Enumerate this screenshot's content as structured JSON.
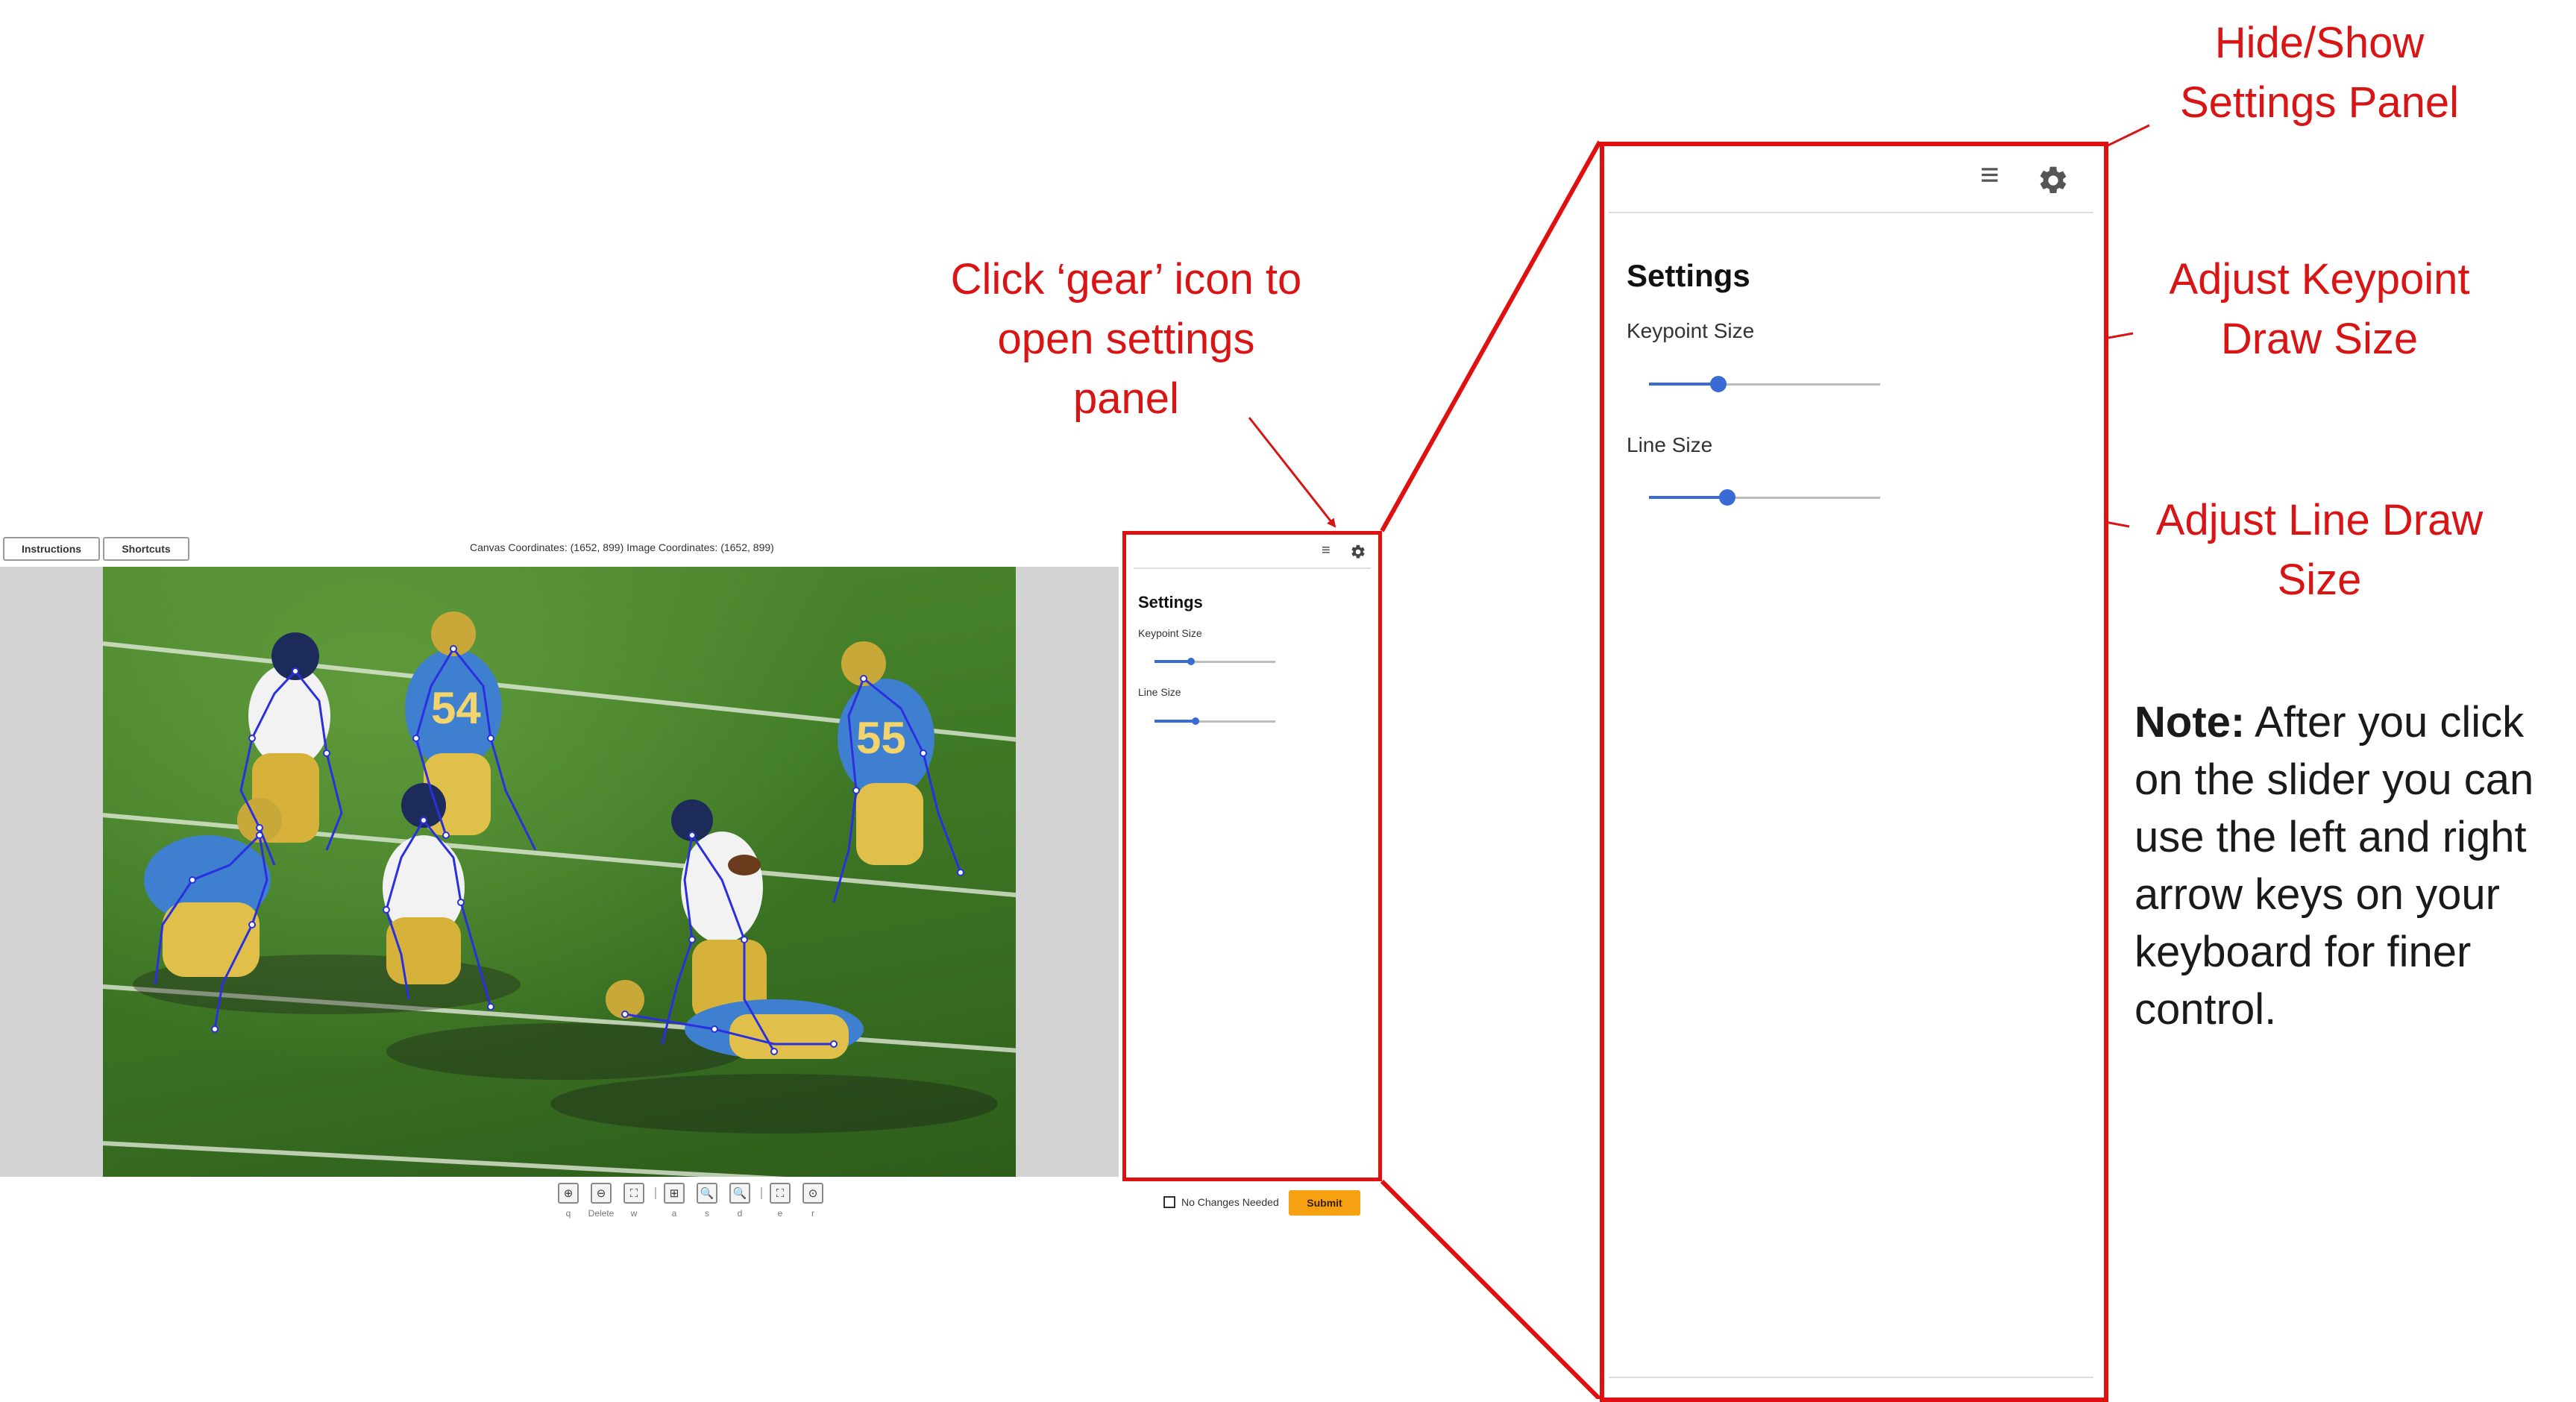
{
  "topbar": {
    "instructions_label": "Instructions",
    "shortcuts_label": "Shortcuts",
    "coordinates_text": "Canvas Coordinates: (1652, 899) Image Coordinates: (1652, 899)"
  },
  "toolbar": {
    "tools": [
      {
        "icon": "add-point-icon",
        "glyph": "⊕",
        "key": "q"
      },
      {
        "icon": "remove-point-icon",
        "glyph": "⊖",
        "key": "Delete"
      },
      {
        "icon": "fit-frame-icon",
        "glyph": "⛶",
        "key": "w"
      },
      {
        "icon": "zoom-region-icon",
        "glyph": "⊞",
        "key": "a"
      },
      {
        "icon": "zoom-out-icon",
        "glyph": "🔍",
        "key": "s"
      },
      {
        "icon": "zoom-in-icon",
        "glyph": "🔍",
        "key": "d"
      },
      {
        "icon": "reset-view-icon",
        "glyph": "⛶",
        "key": "e"
      },
      {
        "icon": "rotate-icon",
        "glyph": "⊙",
        "key": "r"
      }
    ]
  },
  "settings_panel": {
    "menu_icon": "hamburger-menu-icon",
    "gear_icon": "gear-icon",
    "title": "Settings",
    "keypoint_size_label": "Keypoint Size",
    "keypoint_size_value": 0.3,
    "line_size_label": "Line Size",
    "line_size_value": 0.34
  },
  "footer": {
    "no_changes_label": "No Changes Needed",
    "no_changes_checked": false,
    "submit_label": "Submit"
  },
  "annotations": {
    "hide_show": "Hide/Show\nSettings Panel",
    "click_gear": "Click ‘gear’ icon to\nopen settings\npanel",
    "adjust_keypoint": "Adjust Keypoint\nDraw Size",
    "adjust_line": "Adjust Line Draw\nSize",
    "note_bold": "Note:",
    "note_text": " After you click on the slider you can use the left and right arrow keys on your keyboard for finer control."
  },
  "colors": {
    "highlight_red": "#e01010",
    "annotation_red": "#d81414",
    "slider_blue": "#3a6ad4",
    "submit_orange": "#f5a111",
    "canvas_gray": "#d3d3d3"
  }
}
